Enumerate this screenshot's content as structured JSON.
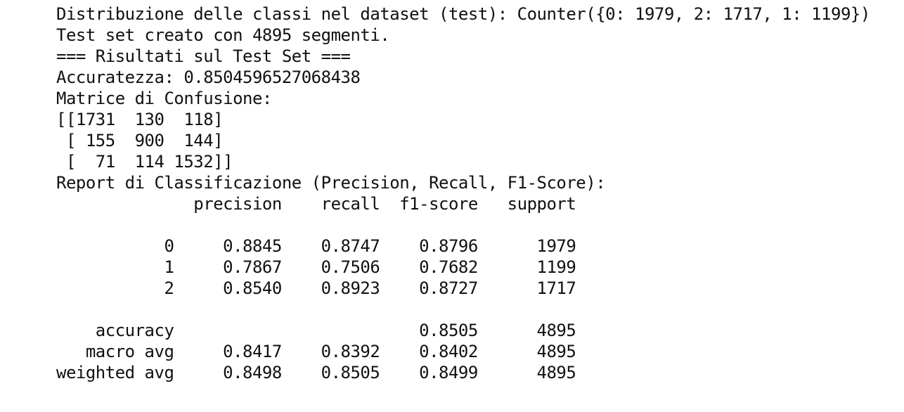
{
  "output": {
    "lines": [
      "Distribuzione delle classi nel dataset (test): Counter({0: 1979, 2: 1717, 1: 1199})",
      "Test set creato con 4895 segmenti.",
      "=== Risultati sul Test Set ===",
      "Accuratezza: 0.8504596527068438",
      "Matrice di Confusione:",
      "[[1731  130  118]",
      " [ 155  900  144]",
      " [  71  114 1532]]",
      "Report di Classificazione (Precision, Recall, F1-Score):",
      "              precision    recall  f1-score   support",
      "",
      "           0     0.8845    0.8747    0.8796      1979",
      "           1     0.7867    0.7506    0.7682      1199",
      "           2     0.8540    0.8923    0.8727      1717",
      "",
      "    accuracy                         0.8505      4895",
      "   macro avg     0.8417    0.8392    0.8402      4895",
      "weighted avg     0.8498    0.8505    0.8499      4895"
    ]
  }
}
